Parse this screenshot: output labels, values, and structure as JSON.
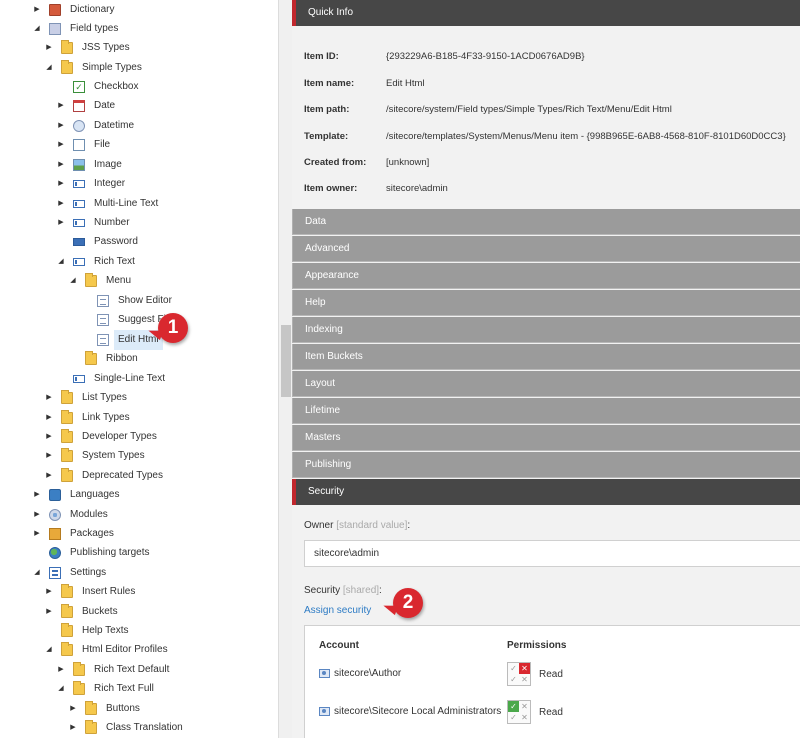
{
  "tree": {
    "items": [
      {
        "label": "Dictionary",
        "icon": "dictionary-book-icon",
        "arrow": "collapsed"
      },
      {
        "label": "Field types",
        "icon": "document-list-icon",
        "arrow": "expanded"
      },
      {
        "label": "JSS Types",
        "icon": "folder-icon",
        "arrow": "collapsed"
      },
      {
        "label": "Simple Types",
        "icon": "folder-icon",
        "arrow": "expanded"
      },
      {
        "label": "Checkbox",
        "icon": "checkbox-icon",
        "arrow": "none"
      },
      {
        "label": "Date",
        "icon": "calendar-icon",
        "arrow": "collapsed"
      },
      {
        "label": "Datetime",
        "icon": "datetime-icon",
        "arrow": "collapsed"
      },
      {
        "label": "File",
        "icon": "file-icon",
        "arrow": "collapsed"
      },
      {
        "label": "Image",
        "icon": "image-icon",
        "arrow": "collapsed"
      },
      {
        "label": "Integer",
        "icon": "field-icon",
        "arrow": "collapsed"
      },
      {
        "label": "Multi-Line Text",
        "icon": "field-icon",
        "arrow": "collapsed"
      },
      {
        "label": "Number",
        "icon": "field-icon",
        "arrow": "collapsed"
      },
      {
        "label": "Password",
        "icon": "password-field-icon",
        "arrow": "none"
      },
      {
        "label": "Rich Text",
        "icon": "field-icon",
        "arrow": "expanded"
      },
      {
        "label": "Menu",
        "icon": "folder-icon",
        "arrow": "expanded"
      },
      {
        "label": "Show Editor",
        "icon": "document-icon",
        "arrow": "none"
      },
      {
        "label": "Suggest Fix",
        "icon": "document-icon",
        "arrow": "none"
      },
      {
        "label": "Edit Html",
        "icon": "document-icon",
        "arrow": "none",
        "selected": true
      },
      {
        "label": "Ribbon",
        "icon": "folder-icon",
        "arrow": "none"
      },
      {
        "label": "Single-Line Text",
        "icon": "field-icon",
        "arrow": "none"
      },
      {
        "label": "List Types",
        "icon": "folder-icon",
        "arrow": "collapsed"
      },
      {
        "label": "Link Types",
        "icon": "folder-icon",
        "arrow": "collapsed"
      },
      {
        "label": "Developer Types",
        "icon": "folder-icon",
        "arrow": "collapsed"
      },
      {
        "label": "System Types",
        "icon": "folder-icon",
        "arrow": "collapsed"
      },
      {
        "label": "Deprecated Types",
        "icon": "folder-icon",
        "arrow": "collapsed"
      },
      {
        "label": "Languages",
        "icon": "languages-icon",
        "arrow": "collapsed"
      },
      {
        "label": "Modules",
        "icon": "modules-icon",
        "arrow": "collapsed"
      },
      {
        "label": "Packages",
        "icon": "packages-icon",
        "arrow": "collapsed"
      },
      {
        "label": "Publishing targets",
        "icon": "globe-icon",
        "arrow": "none"
      },
      {
        "label": "Settings",
        "icon": "settings-icon",
        "arrow": "expanded"
      },
      {
        "label": "Insert Rules",
        "icon": "folder-icon",
        "arrow": "collapsed"
      },
      {
        "label": "Buckets",
        "icon": "folder-icon",
        "arrow": "collapsed"
      },
      {
        "label": "Help Texts",
        "icon": "folder-icon",
        "arrow": "none"
      },
      {
        "label": "Html Editor Profiles",
        "icon": "folder-icon",
        "arrow": "expanded"
      },
      {
        "label": "Rich Text Default",
        "icon": "folder-icon",
        "arrow": "collapsed"
      },
      {
        "label": "Rich Text Full",
        "icon": "folder-icon",
        "arrow": "expanded"
      },
      {
        "label": "Buttons",
        "icon": "folder-icon",
        "arrow": "collapsed"
      },
      {
        "label": "Class Translation",
        "icon": "folder-icon",
        "arrow": "collapsed"
      }
    ]
  },
  "callouts": {
    "one": "1",
    "two": "2"
  },
  "quick_info": {
    "title": "Quick Info",
    "rows": [
      {
        "key": "Item ID:",
        "value": "{293229A6-B185-4F33-9150-1ACD0676AD9B}"
      },
      {
        "key": "Item name:",
        "value": "Edit Html"
      },
      {
        "key": "Item path:",
        "value": "/sitecore/system/Field types/Simple Types/Rich Text/Menu/Edit Html"
      },
      {
        "key": "Template:",
        "value": "/sitecore/templates/System/Menus/Menu item - {998B965E-6AB8-4568-810F-8101D60D0CC3}"
      },
      {
        "key": "Created from:",
        "value": "[unknown]"
      },
      {
        "key": "Item owner:",
        "value": "sitecore\\admin"
      }
    ]
  },
  "sections": [
    "Data",
    "Advanced",
    "Appearance",
    "Help",
    "Indexing",
    "Item Buckets",
    "Layout",
    "Lifetime",
    "Masters",
    "Publishing"
  ],
  "security": {
    "title": "Security",
    "owner_label": "Owner",
    "owner_note": "[standard value]",
    "owner_colon": ":",
    "owner_value": "sitecore\\admin",
    "security_label": "Security",
    "security_note": "[shared]",
    "security_colon": ":",
    "assign_link": "Assign security",
    "table": {
      "col_account": "Account",
      "col_permissions": "Permissions",
      "rows": [
        {
          "account": "sitecore\\Author",
          "permission": "Read",
          "state": "deny"
        },
        {
          "account": "sitecore\\Sitecore Local Administrators",
          "permission": "Read",
          "state": "allow"
        }
      ]
    }
  },
  "colors": {
    "accent_red": "#c0272d",
    "header_dark": "#474747",
    "section_gray": "#9b9b9b",
    "link_blue": "#2d7bc4",
    "selected_bg": "#dcebf9",
    "callout_red": "#d9282f"
  }
}
